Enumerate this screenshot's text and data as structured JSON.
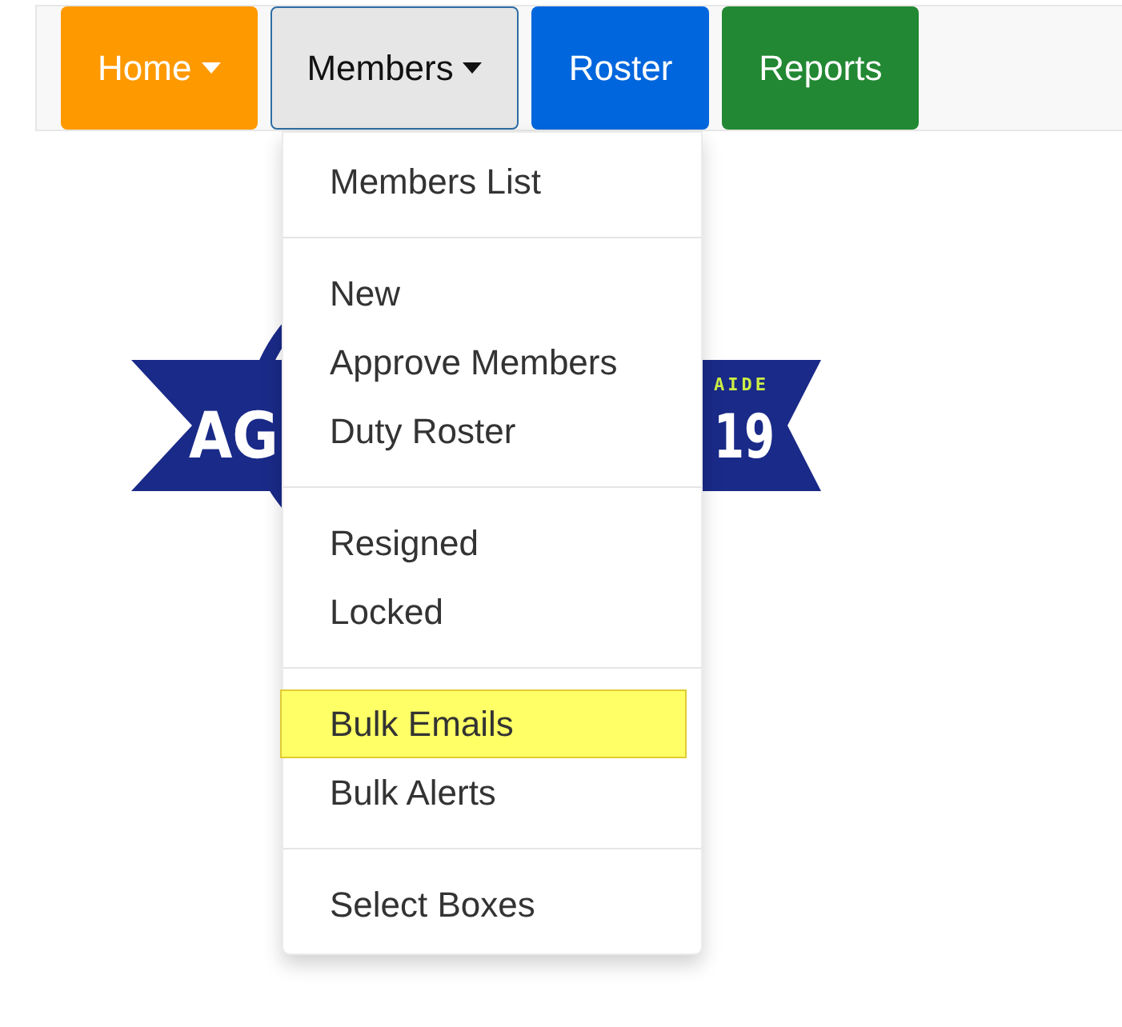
{
  "nav": [
    {
      "label": "Home",
      "color": "#ff9900",
      "caret": true,
      "selected": false
    },
    {
      "label": "Members",
      "caret": true,
      "selected": true
    },
    {
      "label": "Roster",
      "color": "#0066dd",
      "caret": false,
      "selected": false
    },
    {
      "label": "Reports",
      "color": "#228833",
      "caret": false,
      "selected": false
    }
  ],
  "logo": {
    "left_text": "AG",
    "right_top_text": "AIDE",
    "right_text": "19"
  },
  "dropdown": {
    "sections": [
      [
        {
          "label": "Members List",
          "selected": false
        }
      ],
      [
        {
          "label": "New",
          "selected": false
        },
        {
          "label": "Approve Members",
          "selected": false
        },
        {
          "label": "Duty Roster",
          "selected": false
        }
      ],
      [
        {
          "label": "Resigned",
          "selected": false
        },
        {
          "label": "Locked",
          "selected": false
        }
      ],
      [
        {
          "label": "Bulk Emails",
          "selected": true
        },
        {
          "label": "Bulk Alerts",
          "selected": false
        }
      ],
      [
        {
          "label": "Select Boxes",
          "selected": false
        }
      ]
    ]
  }
}
